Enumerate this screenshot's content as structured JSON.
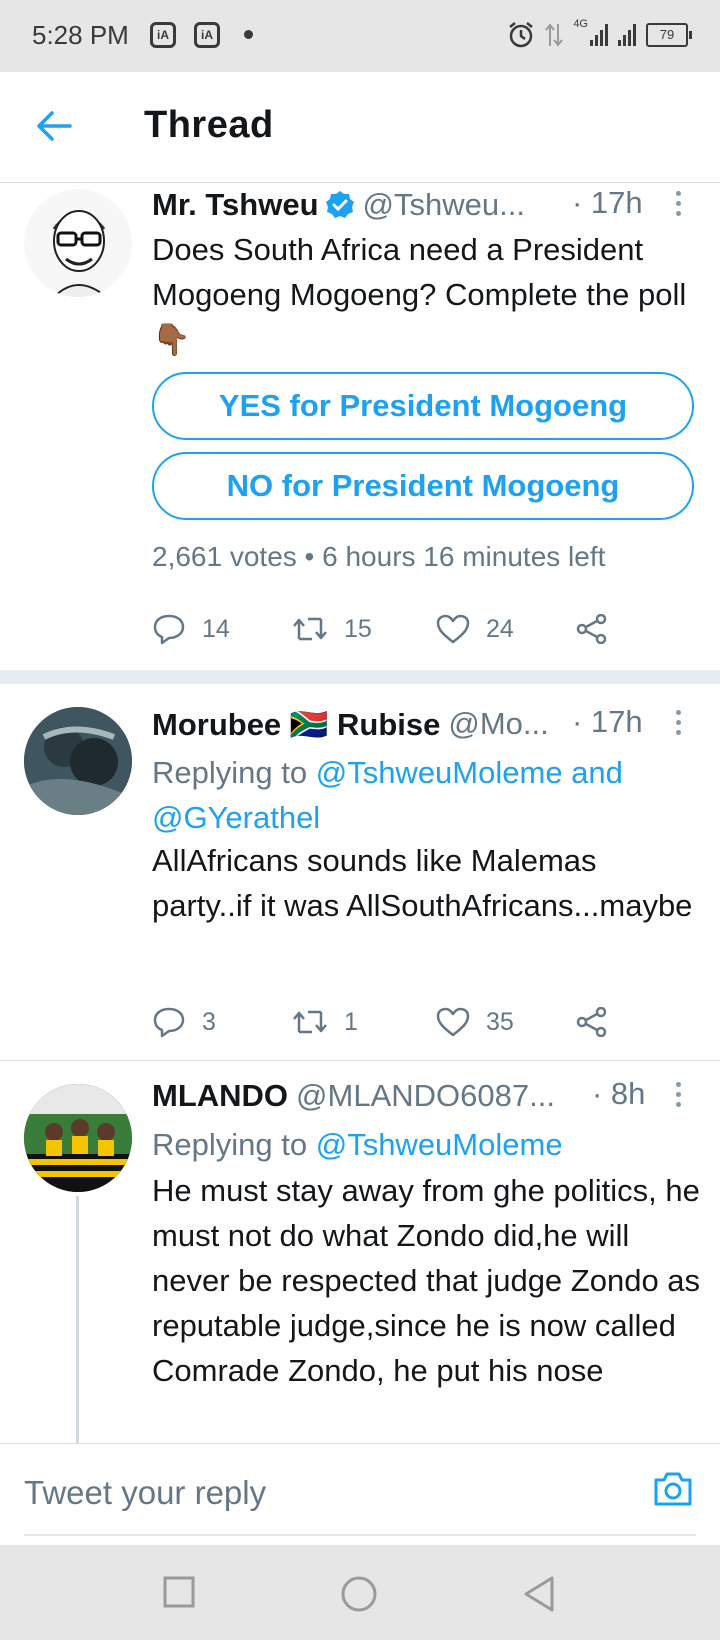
{
  "status_bar": {
    "time": "5:28 PM",
    "network": "4G",
    "battery": "79"
  },
  "header": {
    "title": "Thread"
  },
  "tweets": [
    {
      "name": "Mr. Tshweu",
      "verified": true,
      "handle": "@Tshweu...",
      "time": "· 17h",
      "text": "Does South Africa need a President Mogoeng Mogoeng? Complete the poll 👇🏾",
      "poll": {
        "options": [
          "YES for President Mogoeng",
          "NO for President Mogoeng"
        ],
        "meta": "2,661 votes • 6 hours 16 minutes left"
      },
      "counts": {
        "replies": "14",
        "retweets": "15",
        "likes": "24"
      }
    },
    {
      "name": "Morubee 🇿🇦 Rubise",
      "handle": "@Mo...",
      "time": "· 17h",
      "replying_prefix": "Replying to ",
      "replying_to": "@TshweuMoleme and @GYerathel",
      "text": "AllAfricans sounds like Malemas party..if it was AllSouthAfricans...maybe",
      "counts": {
        "replies": "3",
        "retweets": "1",
        "likes": "35"
      }
    },
    {
      "name": "MLANDO",
      "handle": "@MLANDO6087...",
      "time": "· 8h",
      "replying_prefix": "Replying to ",
      "replying_to": "@TshweuMoleme",
      "text": "He must stay away from ghe politics, he must not do what Zondo did,he will never be respected that judge Zondo as reputable judge,since he is now called Comrade Zondo, he put his nose"
    }
  ],
  "reply_bar": {
    "placeholder": "Tweet your reply"
  },
  "icons": {
    "back": "arrow-left-icon",
    "verified": "verified-badge-icon",
    "more": "more-vertical-icon",
    "reply": "comment-icon",
    "retweet": "retweet-icon",
    "like": "heart-icon",
    "share": "share-icon",
    "camera": "camera-icon",
    "nav_recent": "square-icon",
    "nav_home": "circle-icon",
    "nav_back": "triangle-back-icon"
  },
  "colors": {
    "accent": "#1da1f2",
    "secondary_text": "#657786",
    "primary_text": "#14171a"
  }
}
